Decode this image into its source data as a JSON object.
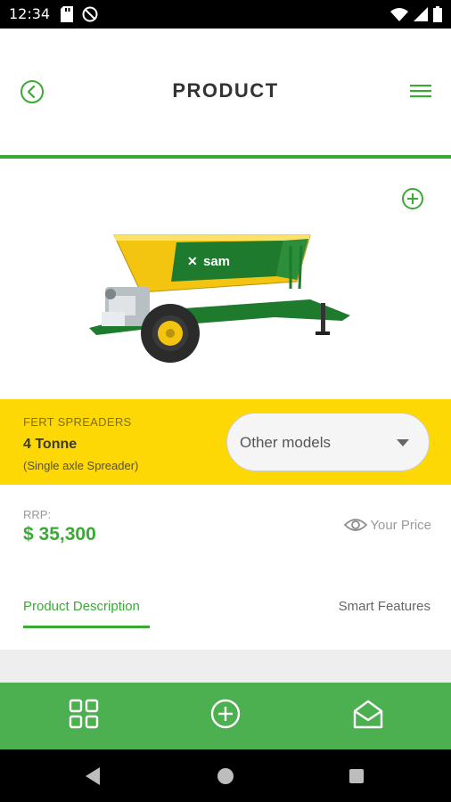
{
  "status_bar": {
    "time": "12:34",
    "left_icons": [
      "sd-card-icon",
      "do-not-disturb-icon"
    ],
    "right_icons": [
      "wifi-icon",
      "signal-icon",
      "battery-icon"
    ]
  },
  "header": {
    "title": "PRODUCT",
    "back_icon": "back-circle-icon",
    "menu_icon": "hamburger-menu-icon"
  },
  "product_image": {
    "add_icon": "add-circle-icon",
    "brand_text": "sam"
  },
  "product_info": {
    "category": "FERT SPREADERS",
    "model": "4 Tonne",
    "subtitle": "(Single axle Spreader)",
    "models_dropdown": "Other models"
  },
  "pricing": {
    "rrp_label": "RRP:",
    "price": "$ 35,300",
    "your_price_label": "Your Price",
    "your_price_icon": "eye-icon"
  },
  "tabs": [
    {
      "label": "Product Description",
      "active": true
    },
    {
      "label": "Smart Features",
      "active": false
    }
  ],
  "bottom_nav": {
    "items": [
      "grid-icon",
      "add-circle-icon",
      "mail-open-icon"
    ]
  },
  "colors": {
    "brand_green": "#3aaa35",
    "brand_yellow": "#fed804",
    "nav_green": "#4caf50"
  }
}
